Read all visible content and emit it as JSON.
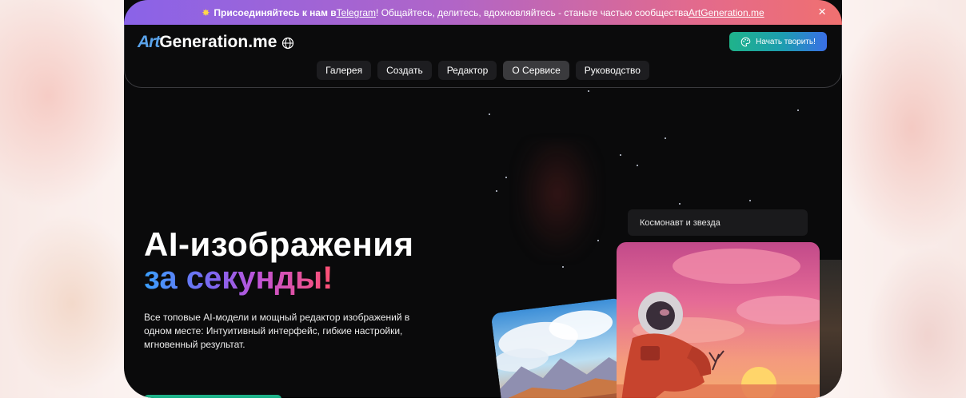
{
  "announcement": {
    "prefix": "Присоединяйтесь к нам в ",
    "telegram_link": "Telegram",
    "middle": "! Общайтесь, делитесь, вдохновляйтесь - станьте частью сообщества ",
    "site_link": "ArtGeneration.me",
    "close_icon": "×"
  },
  "logo": {
    "art": "Art",
    "rest": "Generation.me"
  },
  "cta": {
    "label": "Начать творить!"
  },
  "nav": {
    "items": [
      {
        "label": "Галерея"
      },
      {
        "label": "Создать"
      },
      {
        "label": "Редактор"
      },
      {
        "label": "О Сервисе"
      },
      {
        "label": "Руководство"
      }
    ]
  },
  "hero": {
    "title": "AI-изображения",
    "accent": "за секунды!",
    "description": "Все топовые AI-модели и мощный редактор изображений в одном месте: Интуитивный интерфейс, гибкие настройки, мгновенный результат."
  },
  "prompt_chip": {
    "text": "Космонавт и звезда"
  },
  "icons": {
    "announce": "sparkle-icon",
    "globe": "globe-icon",
    "palette": "palette-icon",
    "close": "close-icon"
  },
  "colors": {
    "banner_start": "#8a63e8",
    "banner_end": "#f07070",
    "cta_start": "#1fb38a",
    "cta_end": "#3a6fe6",
    "background": "#0a0a0b"
  }
}
